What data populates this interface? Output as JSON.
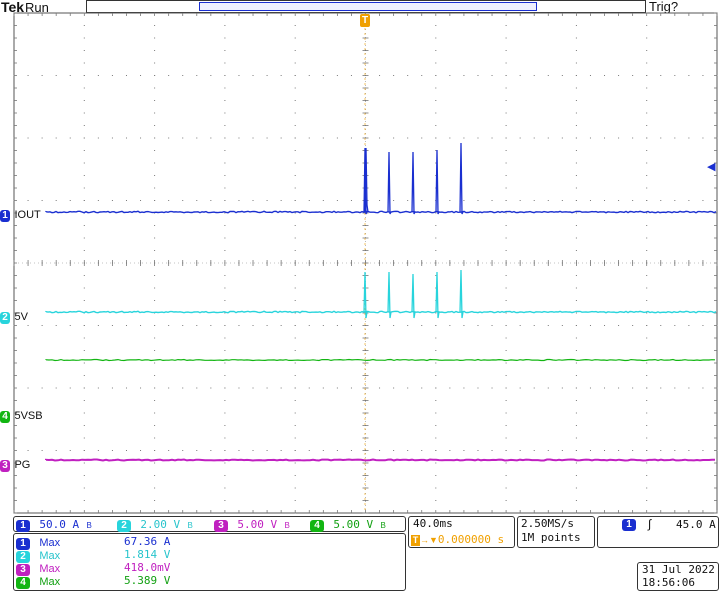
{
  "brand": "Tek",
  "acq_state": "Run",
  "trigger_status": "Trig?",
  "trigger_marker": "T",
  "colors": {
    "ch1": "#1a2fd0",
    "ch2": "#28d4dc",
    "ch3": "#c020c0",
    "ch4": "#12b512",
    "trigger": "#f0a000",
    "grid": "#7a7a7a"
  },
  "channels": [
    {
      "num": "1",
      "label": "IOUT",
      "scale": "50.0 A",
      "bw": "B",
      "measure_type": "Max",
      "measure_value": "67.36 A"
    },
    {
      "num": "2",
      "label": "5V",
      "scale": "2.00 V",
      "bw": "B",
      "measure_type": "Max",
      "measure_value": "1.814 V"
    },
    {
      "num": "3",
      "label": "PG",
      "scale": "5.00 V",
      "bw": "B",
      "measure_type": "Max",
      "measure_value": "418.0mV"
    },
    {
      "num": "4",
      "label": "5VSB",
      "scale": "5.00 V",
      "bw": "B",
      "measure_type": "Max",
      "measure_value": "5.389 V"
    }
  ],
  "timebase": {
    "scale": "40.0ms",
    "delay": "0.000000 s",
    "delay_icon": "trigger-position-icon"
  },
  "sampling": {
    "rate": "2.50MS/s",
    "record": "1M points"
  },
  "trigger": {
    "source": "1",
    "slope": "rising-edge-icon",
    "level": "45.0 A"
  },
  "datetime": {
    "date": "31 Jul  2022",
    "time": "18:56:06"
  }
}
